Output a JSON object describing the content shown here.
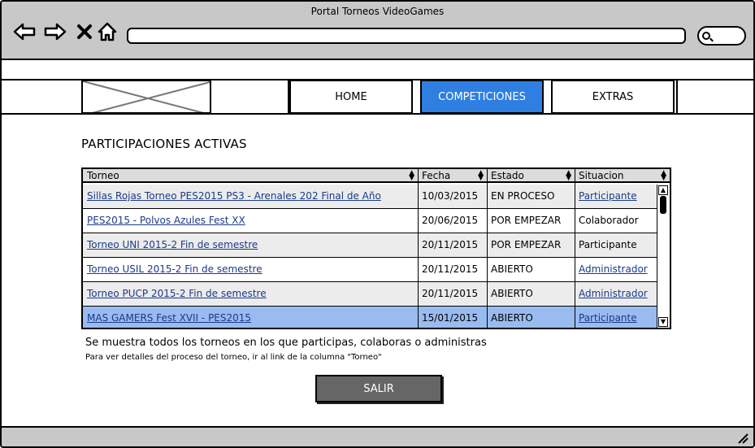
{
  "window": {
    "title": "Portal Torneos VideoGames"
  },
  "toolbar": {
    "back_icon": "back-arrow-icon",
    "forward_icon": "forward-arrow-icon",
    "close_icon": "close-icon",
    "home_icon": "home-icon",
    "search_icon": "search-icon"
  },
  "nav": {
    "items": [
      {
        "label": "HOME",
        "active": false
      },
      {
        "label": "COMPETICIONES",
        "active": true
      },
      {
        "label": "EXTRAS",
        "active": false
      }
    ]
  },
  "main": {
    "section_title": "PARTICIPACIONES ACTIVAS",
    "table": {
      "headers": [
        "Torneo",
        "Fecha",
        "Estado",
        "Situacion"
      ],
      "rows": [
        {
          "torneo": "Sillas Rojas Torneo PES2015 PS3 - Arenales 202 Final de Año",
          "fecha": "10/03/2015",
          "estado": "EN PROCESO",
          "situacion": "Participante",
          "situacion_link": true
        },
        {
          "torneo": "PES2015 - Polvos Azules Fest XX",
          "fecha": "20/06/2015",
          "estado": "POR EMPEZAR",
          "situacion": "Colaborador",
          "situacion_link": false
        },
        {
          "torneo": "Torneo UNI 2015-2 Fin de semestre",
          "fecha": "20/11/2015",
          "estado": "POR EMPEZAR",
          "situacion": "Participante",
          "situacion_link": false
        },
        {
          "torneo": "Torneo USIL 2015-2 Fin de semestre",
          "fecha": "20/11/2015",
          "estado": "ABIERTO",
          "situacion": "Administrador",
          "situacion_link": true
        },
        {
          "torneo": "Torneo PUCP 2015-2 Fin de semestre",
          "fecha": "20/11/2015",
          "estado": "ABIERTO",
          "situacion": "Administrador",
          "situacion_link": true
        },
        {
          "torneo": "MAS GAMERS Fest XVII - PES2015",
          "fecha": "15/01/2015",
          "estado": "ABIERTO",
          "situacion": "Participante",
          "situacion_link": true
        }
      ],
      "selected_row": 5
    },
    "note_main": "Se muestra todos los torneos en los que participas, colaboras o administras",
    "note_detail": "Para ver detalles del proceso del torneo, ir al link de la columna \"Torneo\"",
    "exit_button": "SALIR"
  },
  "colors": {
    "chrome": "#c8c8c8",
    "accent": "#2f7fe3",
    "selected_row": "#99bbf0",
    "link": "#1a3a8a",
    "button": "#666666"
  }
}
